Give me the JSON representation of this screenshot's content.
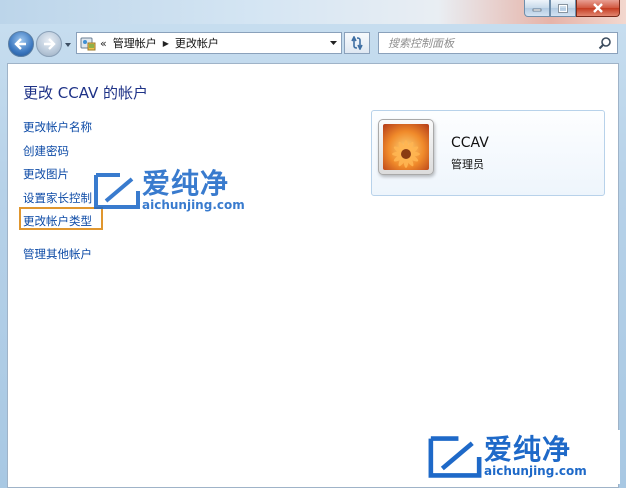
{
  "window": {
    "minimize_icon": "minimize-icon",
    "maximize_icon": "maximize-icon",
    "close_icon": "close-icon"
  },
  "navigation": {
    "address": {
      "chevron": "«",
      "crumbs": [
        "管理帐户",
        "更改帐户"
      ]
    },
    "search": {
      "placeholder": "搜索控制面板"
    }
  },
  "page": {
    "title": "更改 CCAV 的帐户",
    "tasks": [
      {
        "label": "更改帐户名称"
      },
      {
        "label": "创建密码"
      },
      {
        "label": "更改图片"
      },
      {
        "label": "设置家长控制"
      },
      {
        "label": "更改帐户类型",
        "highlighted": true
      },
      {
        "label": "管理其他帐户"
      }
    ],
    "account": {
      "name": "CCAV",
      "role": "管理员",
      "picture_icon": "flower-picture"
    }
  },
  "watermark": {
    "chinese": "爱纯净",
    "domain": "aichunjing.com",
    "color": "#1e69c8"
  },
  "colors": {
    "link": "#0c4aa6",
    "title": "#1e3287",
    "highlight_border": "#e0962e"
  }
}
